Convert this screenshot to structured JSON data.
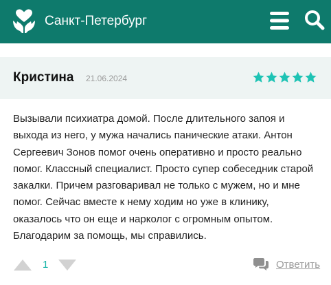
{
  "header": {
    "city": "Санкт-Петербург",
    "logo_icon": "heart-hands-icon",
    "menu_icon": "hamburger-menu-icon",
    "search_icon": "search-icon",
    "background_color": "#0e7a6c"
  },
  "review": {
    "author": "Кристина",
    "date": "21.06.2024",
    "rating": 5,
    "rating_max": 5,
    "star_color": "#1ec3b4",
    "header_background": "#eef4f3",
    "text": "Вызывали психиатра домой. После длительного запоя и выхода из него, у мужа начались панические атаки. Антон Сергеевич Зонов помог очень оперативно и просто реально помог. Классный специалист. Просто супер собеседник старой закалки. Причем разговаривал не только с мужем, но и мне помог. Сейчас вместе к нему ходим но уже в клинику, оказалось что он еще и нарколог с огромным опытом. Благодарим за помощь, мы справились."
  },
  "footer": {
    "vote_count": "1",
    "upvote_icon": "triangle-up-icon",
    "downvote_icon": "triangle-down-icon",
    "reply_icon": "speech-bubbles-icon",
    "reply_label": "Ответить"
  }
}
